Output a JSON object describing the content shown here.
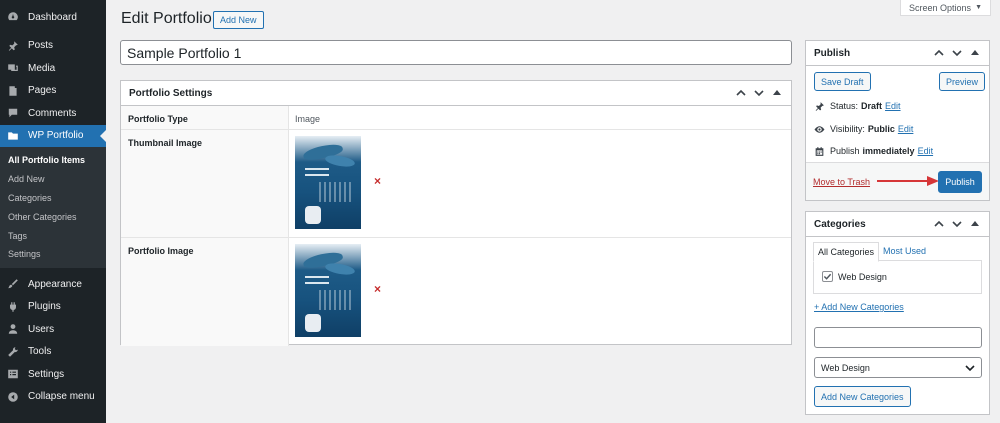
{
  "sidebar": {
    "items": [
      {
        "label": "Dashboard",
        "icon": "dashboard-icon"
      },
      {
        "label": "Posts",
        "icon": "pin-icon"
      },
      {
        "label": "Media",
        "icon": "media-icon"
      },
      {
        "label": "Pages",
        "icon": "pages-icon"
      },
      {
        "label": "Comments",
        "icon": "comment-icon"
      },
      {
        "label": "WP Portfolio",
        "icon": "folder-icon",
        "active": true
      }
    ],
    "submenu": [
      "All Portfolio Items",
      "Add New",
      "Categories",
      "Other Categories",
      "Tags",
      "Settings"
    ],
    "items2": [
      {
        "label": "Appearance",
        "icon": "brush-icon"
      },
      {
        "label": "Plugins",
        "icon": "plug-icon"
      },
      {
        "label": "Users",
        "icon": "user-icon"
      },
      {
        "label": "Tools",
        "icon": "wrench-icon"
      },
      {
        "label": "Settings",
        "icon": "settings-icon"
      },
      {
        "label": "Collapse menu",
        "icon": "collapse-icon"
      }
    ]
  },
  "header": {
    "screen_options": "Screen Options",
    "title": "Edit Portfolio",
    "add_new": "Add New"
  },
  "post_title": "Sample Portfolio 1",
  "portfolio_settings": {
    "heading": "Portfolio Settings",
    "type_label": "Portfolio Type",
    "type_value": "Image",
    "thumbnail_label": "Thumbnail Image",
    "image_label": "Portfolio Image",
    "remove_glyph": "×"
  },
  "publish": {
    "heading": "Publish",
    "save_draft": "Save Draft",
    "preview": "Preview",
    "status_label": "Status:",
    "status_value": "Draft",
    "visibility_label": "Visibility:",
    "visibility_value": "Public",
    "publish_label": "Publish",
    "publish_value": "immediately",
    "edit": "Edit",
    "move_to_trash": "Move to Trash",
    "publish_button": "Publish"
  },
  "categories": {
    "heading": "Categories",
    "tab_all": "All Categories",
    "tab_most_used": "Most Used",
    "items": [
      {
        "label": "Web Design",
        "checked": true
      }
    ],
    "add_new_link": "+ Add New Categories",
    "new_input_value": "",
    "parent_selected": "Web Design",
    "add_button": "Add New Categories"
  },
  "colors": {
    "admin_bar": "#1d2327",
    "accent": "#2271b1",
    "trash": "#b32d2e",
    "annotation_arrow": "#d63638"
  }
}
